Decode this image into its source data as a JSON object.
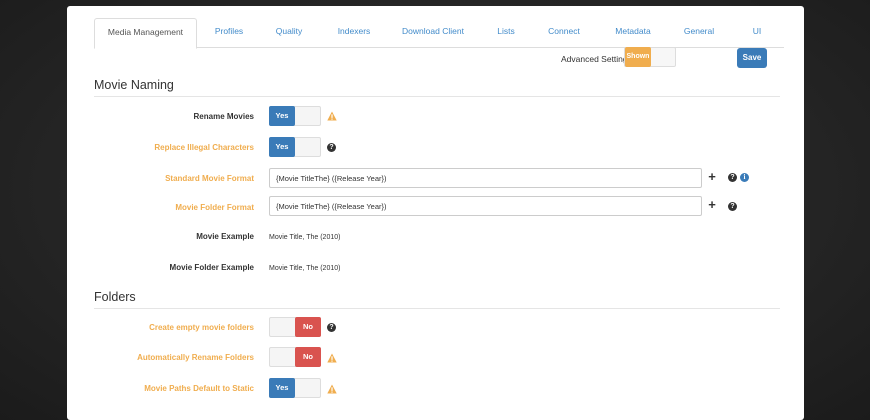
{
  "tabs": [
    {
      "label": "Media Management",
      "active": true
    },
    {
      "label": "Profiles",
      "active": false
    },
    {
      "label": "Quality",
      "active": false
    },
    {
      "label": "Indexers",
      "active": false
    },
    {
      "label": "Download Client",
      "active": false
    },
    {
      "label": "Lists",
      "active": false
    },
    {
      "label": "Connect",
      "active": false
    },
    {
      "label": "Metadata",
      "active": false
    },
    {
      "label": "General",
      "active": false
    },
    {
      "label": "UI",
      "active": false
    }
  ],
  "toolbar": {
    "advanced_label": "Advanced Settings",
    "advanced_state": "Shown",
    "save_label": "Save"
  },
  "movie_naming": {
    "title": "Movie Naming",
    "rename_movies": {
      "label": "Rename Movies",
      "value": "Yes"
    },
    "replace_illegal": {
      "label": "Replace Illegal Characters",
      "value": "Yes"
    },
    "standard_format": {
      "label": "Standard Movie Format",
      "value": "{Movie TitleThe} ({Release Year})"
    },
    "folder_format": {
      "label": "Movie Folder Format",
      "value": "{Movie TitleThe} ({Release Year})"
    },
    "movie_example": {
      "label": "Movie Example",
      "value": "Movie Title, The (2010)"
    },
    "folder_example": {
      "label": "Movie Folder Example",
      "value": "Movie Title, The (2010)"
    }
  },
  "folders": {
    "title": "Folders",
    "create_empty": {
      "label": "Create empty movie folders",
      "value": "No"
    },
    "auto_rename": {
      "label": "Automatically Rename Folders",
      "value": "No"
    },
    "paths_static": {
      "label": "Movie Paths Default to Static",
      "value": "Yes"
    }
  },
  "icons": {
    "plus": "+",
    "help": "?",
    "info": "i"
  },
  "colors": {
    "primary": "#3a7bb8",
    "warning": "#f0ad4e",
    "danger": "#d9534f",
    "link": "#428bca"
  }
}
